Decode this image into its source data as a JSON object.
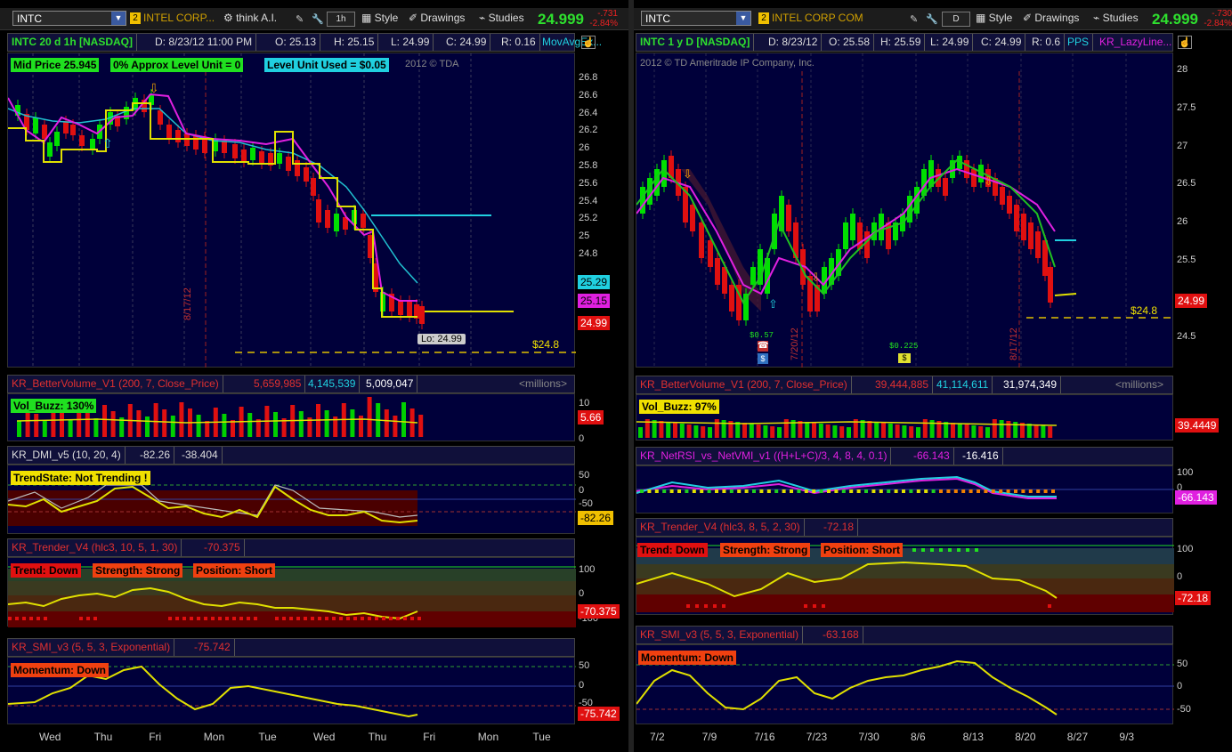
{
  "left": {
    "toolbar": {
      "symbol": "INTC",
      "badge": "2",
      "company": "INTEL CORP...",
      "think": "think A.I.",
      "interval": "1h",
      "style": "Style",
      "drawings": "Drawings",
      "studies": "Studies",
      "price": "24.999",
      "chg1": "-.731",
      "chg2": "-2.84%"
    },
    "header": {
      "title": "INTC 20 d 1h [NASDAQ]",
      "date": "D: 8/23/12 11:00 PM",
      "open": "O: 25.13",
      "high": "H: 25.15",
      "low": "L: 24.99",
      "close": "C: 24.99",
      "range": "R: 0.16",
      "study": "MovAvgEx..."
    },
    "tags": {
      "mid": "Mid Price 25.945",
      "approx": "0% Approx Level Unit = 0",
      "used": "Level Unit Used = $0.05",
      "copyright": "2012 © TDA"
    },
    "yaxis": [
      "26.8",
      "26.6",
      "26.4",
      "26.2",
      "26",
      "25.8",
      "25.6",
      "25.4",
      "25.2",
      "25",
      "24.8"
    ],
    "priceboxes": {
      "cyan": "25.29",
      "magenta": "25.15",
      "red": "24.99"
    },
    "lo_label": "Lo: 24.99",
    "level": "$24.8",
    "vline": "8/17/12",
    "vol": {
      "name": "KR_BetterVolume_V1 (200, 7, Close_Price)",
      "v1": "5,659,985",
      "v2": "4,145,539",
      "v3": "5,009,047",
      "units": "<millions>",
      "buzz": "Vol_Buzz: 130%",
      "y": [
        "10",
        "5",
        "0"
      ],
      "box": "5.66"
    },
    "dmi": {
      "name": "KR_DMI_v5 (10, 20, 4)",
      "v1": "-82.26",
      "v2": "-38.404",
      "state": "TrendState: Not Trending !",
      "y": [
        "50",
        "0",
        "-50"
      ],
      "box": "-82.26"
    },
    "trender": {
      "name": "KR_Trender_V4 (hlc3, 10, 5, 1, 30)",
      "v1": "-70.375",
      "trend": "Trend: Down",
      "strength": "Strength: Strong",
      "position": "Position: Short",
      "y": [
        "100",
        "0",
        "-100"
      ],
      "box": "-70.375"
    },
    "smi": {
      "name": "KR_SMI_v3 (5, 5, 3, Exponential)",
      "v1": "-75.742",
      "momentum": "Momentum: Down",
      "y": [
        "50",
        "0",
        "-50"
      ],
      "box": "-75.742"
    },
    "xaxis": [
      "Wed",
      "Thu",
      "Fri",
      "Mon",
      "Tue",
      "Wed",
      "Thu",
      "Fri",
      "Mon",
      "Tue"
    ]
  },
  "right": {
    "toolbar": {
      "symbol": "INTC",
      "badge": "2",
      "company": "INTEL CORP COM",
      "interval": "D",
      "style": "Style",
      "drawings": "Drawings",
      "studies": "Studies",
      "price": "24.999",
      "chg1": "-.730",
      "chg2": "-2.84%"
    },
    "header": {
      "title": "INTC 1 y D [NASDAQ]",
      "date": "D: 8/23/12",
      "open": "O: 25.58",
      "high": "H: 25.59",
      "low": "L: 24.99",
      "close": "C: 24.99",
      "range": "R: 0.6",
      "pps": "PPS",
      "study": "KR_LazyLine..."
    },
    "copyright": "2012 © TD Ameritrade IP Company, Inc.",
    "yaxis": [
      "28",
      "27.5",
      "27",
      "26.5",
      "26",
      "25.5",
      "25",
      "24.5"
    ],
    "pricebox": "24.99",
    "level": "$24.8",
    "vline1": "7/20/12",
    "vline2": "8/17/12",
    "div1": "$0.57",
    "div2": "$0.225",
    "vol": {
      "name": "KR_BetterVolume_V1 (200, 7, Close_Price)",
      "v1": "39,444,885",
      "v2": "41,114,611",
      "v3": "31,974,349",
      "units": "<millions>",
      "buzz": "Vol_Buzz: 97%",
      "box": "39.4449"
    },
    "rsi": {
      "name": "KR_NetRSI_vs_NetVMI_v1 ((H+L+C)/3, 4, 8, 4, 0.1)",
      "v1": "-66.143",
      "v2": "-16.416",
      "y": [
        "100",
        "0"
      ],
      "box": "-66.143"
    },
    "trender": {
      "name": "KR_Trender_V4 (hlc3, 8, 5, 2, 30)",
      "v1": "-72.18",
      "trend": "Trend: Down",
      "strength": "Strength: Strong",
      "position": "Position: Short",
      "y": [
        "100",
        "0"
      ],
      "box": "-72.18"
    },
    "smi": {
      "name": "KR_SMI_v3 (5, 5, 3, Exponential)",
      "v1": "-63.168",
      "momentum": "Momentum: Down",
      "y": [
        "50",
        "0",
        "-50"
      ]
    },
    "xaxis": [
      "7/2",
      "7/9",
      "7/16",
      "7/23",
      "7/30",
      "8/6",
      "8/13",
      "8/20",
      "8/27",
      "9/3"
    ]
  },
  "colors": {
    "up": "#00e000",
    "down": "#e01010",
    "bg": "#00003a",
    "yellow": "#f0e000",
    "magenta": "#e020e0",
    "cyan": "#20d0e0"
  }
}
